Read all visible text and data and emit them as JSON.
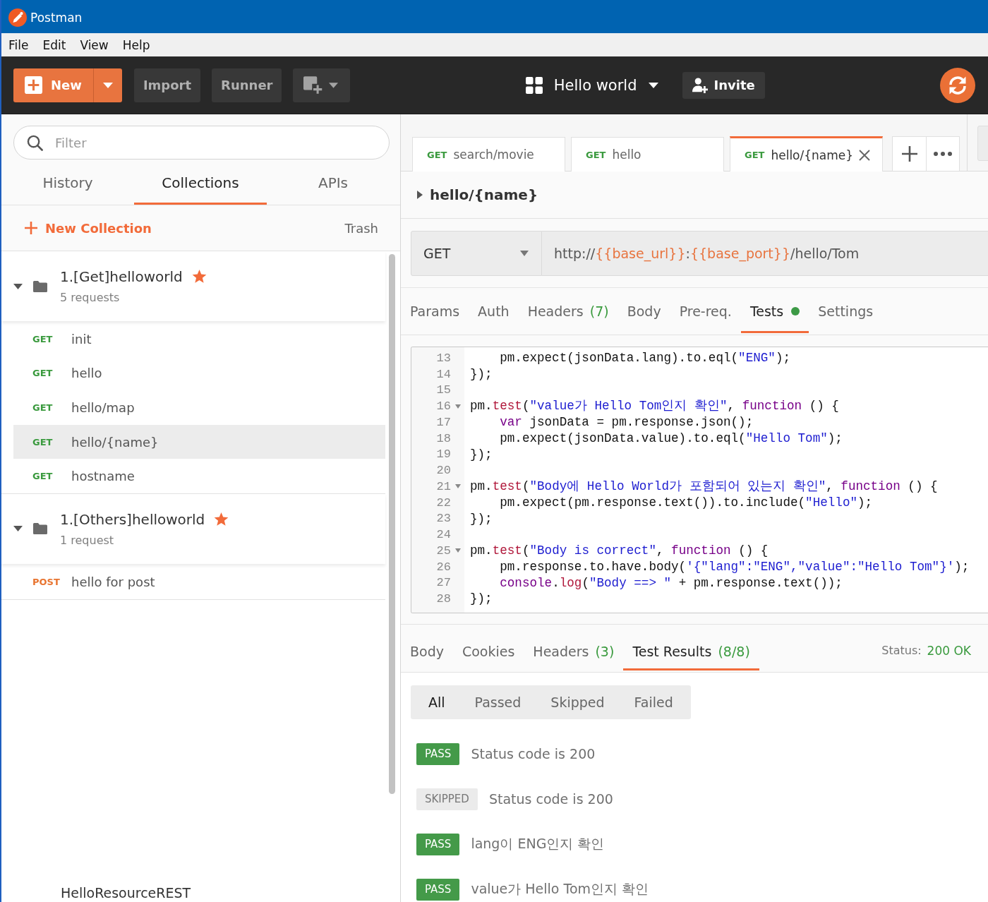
{
  "window": {
    "title": "Postman"
  },
  "menu_bar": [
    {
      "label": "File"
    },
    {
      "label": "Edit"
    },
    {
      "label": "View"
    },
    {
      "label": "Help"
    }
  ],
  "toolbar": {
    "new_button": "New",
    "import_button": "Import",
    "runner_button": "Runner",
    "workspace": "Hello world",
    "invite_button": "Invite"
  },
  "sidebar": {
    "filter": {
      "placeholder": "Filter"
    },
    "tabs": [
      {
        "label": "History",
        "selected": false
      },
      {
        "label": "Collections",
        "selected": true
      },
      {
        "label": "APIs",
        "selected": false
      }
    ],
    "new_collection": "New Collection",
    "trash": "Trash",
    "collections": [
      {
        "name": "1.[Get]helloworld",
        "favorite": true,
        "expanded": true,
        "count": "5 requests",
        "requests": [
          {
            "method": "GET",
            "color": "#3a9a3e",
            "name": "init",
            "selected": false
          },
          {
            "method": "GET",
            "color": "#3a9a3e",
            "name": "hello",
            "selected": false
          },
          {
            "method": "GET",
            "color": "#3a9a3e",
            "name": "hello/map",
            "selected": false
          },
          {
            "method": "GET",
            "color": "#3a9a3e",
            "name": "hello/{name}",
            "selected": true
          },
          {
            "method": "GET",
            "color": "#3a9a3e",
            "name": "hostname",
            "selected": false
          }
        ]
      },
      {
        "name": "1.[Others]helloworld",
        "favorite": true,
        "expanded": true,
        "count": "1 request",
        "requests": [
          {
            "method": "POST",
            "color": "#e8742f",
            "name": "hello for post",
            "selected": false
          }
        ]
      }
    ],
    "last_collection": "HelloResourceREST"
  },
  "tabs": [
    {
      "method": "GET",
      "name": "search/movie",
      "selected": false
    },
    {
      "method": "GET",
      "name": "hello",
      "selected": false
    },
    {
      "method": "GET",
      "name": "hello/{name}",
      "selected": true
    }
  ],
  "request": {
    "title": "hello/{name}",
    "method": "GET",
    "url": [
      {
        "kind": "text",
        "text": "http://"
      },
      {
        "kind": "variable",
        "text": "{{base_url}}"
      },
      {
        "kind": "text",
        "text": ":"
      },
      {
        "kind": "variable",
        "text": "{{base_port}}"
      },
      {
        "kind": "text",
        "text": "/hello/Tom"
      }
    ],
    "tabs": [
      {
        "label": "Params",
        "selected": false,
        "indicator": false
      },
      {
        "label": "Auth",
        "selected": false,
        "indicator": false
      },
      {
        "label": "Headers",
        "count": "(7)",
        "selected": false,
        "indicator": false
      },
      {
        "label": "Body",
        "selected": false,
        "indicator": false
      },
      {
        "label": "Pre-req.",
        "selected": false,
        "indicator": false
      },
      {
        "label": "Tests",
        "selected": true,
        "indicator": true
      },
      {
        "label": "Settings",
        "selected": false,
        "indicator": false
      }
    ]
  },
  "editor": {
    "lines": [
      {
        "number": "13",
        "foldable": false,
        "indented": true,
        "tokens": [
          {
            "kind": "plain",
            "text": "pm.expect(jsonData.lang).to.eql("
          },
          {
            "kind": "string",
            "text": "\"ENG\""
          },
          {
            "kind": "plain",
            "text": ");"
          }
        ]
      },
      {
        "number": "14",
        "foldable": false,
        "indented": false,
        "tokens": [
          {
            "kind": "plain",
            "text": "});"
          }
        ]
      },
      {
        "number": "15",
        "foldable": false
      },
      {
        "number": "16",
        "foldable": true,
        "indented": false,
        "tokens": [
          {
            "kind": "plain",
            "text": "pm."
          },
          {
            "kind": "call",
            "text": "test"
          },
          {
            "kind": "plain",
            "text": "("
          },
          {
            "kind": "string",
            "text": "\"value가 Hello Tom인지 확인\""
          },
          {
            "kind": "plain",
            "text": ", "
          },
          {
            "kind": "keyword",
            "text": "function"
          },
          {
            "kind": "plain",
            "text": " () {"
          }
        ]
      },
      {
        "number": "17",
        "foldable": false,
        "indented": true,
        "tokens": [
          {
            "kind": "keyword",
            "text": "var"
          },
          {
            "kind": "plain",
            "text": " jsonData = pm.response.json();"
          }
        ]
      },
      {
        "number": "18",
        "foldable": false,
        "indented": true,
        "tokens": [
          {
            "kind": "plain",
            "text": "pm.expect(jsonData.value).to.eql("
          },
          {
            "kind": "string",
            "text": "\"Hello Tom\""
          },
          {
            "kind": "plain",
            "text": ");"
          }
        ]
      },
      {
        "number": "19",
        "foldable": false,
        "indented": false,
        "tokens": [
          {
            "kind": "plain",
            "text": "});"
          }
        ]
      },
      {
        "number": "20",
        "foldable": false
      },
      {
        "number": "21",
        "foldable": true,
        "indented": false,
        "tokens": [
          {
            "kind": "plain",
            "text": "pm."
          },
          {
            "kind": "call",
            "text": "test"
          },
          {
            "kind": "plain",
            "text": "("
          },
          {
            "kind": "string",
            "text": "\"Body에 Hello World가 포함되어 있는지 확인\""
          },
          {
            "kind": "plain",
            "text": ", "
          },
          {
            "kind": "keyword",
            "text": "function"
          },
          {
            "kind": "plain",
            "text": " () {"
          }
        ]
      },
      {
        "number": "22",
        "foldable": false,
        "indented": true,
        "tokens": [
          {
            "kind": "plain",
            "text": "pm.expect(pm.response.text()).to.include("
          },
          {
            "kind": "string",
            "text": "\"Hello\""
          },
          {
            "kind": "plain",
            "text": ");"
          }
        ]
      },
      {
        "number": "23",
        "foldable": false,
        "indented": false,
        "tokens": [
          {
            "kind": "plain",
            "text": "});"
          }
        ]
      },
      {
        "number": "24",
        "foldable": false
      },
      {
        "number": "25",
        "foldable": true,
        "indented": false,
        "tokens": [
          {
            "kind": "plain",
            "text": "pm."
          },
          {
            "kind": "call",
            "text": "test"
          },
          {
            "kind": "plain",
            "text": "("
          },
          {
            "kind": "string",
            "text": "\"Body is correct\""
          },
          {
            "kind": "plain",
            "text": ", "
          },
          {
            "kind": "keyword",
            "text": "function"
          },
          {
            "kind": "plain",
            "text": " () {"
          }
        ]
      },
      {
        "number": "26",
        "foldable": false,
        "indented": true,
        "tokens": [
          {
            "kind": "plain",
            "text": "pm.response.to.have.body("
          },
          {
            "kind": "string",
            "text": "'{\"lang\":\"ENG\",\"value\":\"Hello Tom\"}'"
          },
          {
            "kind": "plain",
            "text": ");"
          }
        ]
      },
      {
        "number": "27",
        "foldable": false,
        "indented": true,
        "tokens": [
          {
            "kind": "keyword",
            "text": "console"
          },
          {
            "kind": "plain",
            "text": "."
          },
          {
            "kind": "call",
            "text": "log"
          },
          {
            "kind": "plain",
            "text": "("
          },
          {
            "kind": "string",
            "text": "\"Body ==> \""
          },
          {
            "kind": "plain",
            "text": " + pm.response.text());"
          }
        ]
      },
      {
        "number": "28",
        "foldable": false,
        "indented": false,
        "tokens": [
          {
            "kind": "plain",
            "text": "});"
          }
        ]
      }
    ]
  },
  "response": {
    "tabs": [
      {
        "label": "Body",
        "selected": false
      },
      {
        "label": "Cookies",
        "selected": false
      },
      {
        "label": "Headers",
        "count": "(3)",
        "selected": false
      },
      {
        "label": "Test Results",
        "count": "(8/8)",
        "selected": true
      }
    ],
    "status_label": "Status:",
    "status": "200 OK",
    "filters": [
      {
        "label": "All",
        "selected": true
      },
      {
        "label": "Passed",
        "selected": false
      },
      {
        "label": "Skipped",
        "selected": false
      },
      {
        "label": "Failed",
        "selected": false
      }
    ],
    "results": [
      {
        "kind": "pass",
        "badge": "PASS",
        "name": "Status code is 200"
      },
      {
        "kind": "skipped",
        "badge": "SKIPPED",
        "name": "Status code is 200"
      },
      {
        "kind": "pass",
        "badge": "PASS",
        "name": "lang이 ENG인지 확인"
      },
      {
        "kind": "pass",
        "badge": "PASS",
        "name": "value가 Hello Tom인지 확인"
      }
    ]
  }
}
